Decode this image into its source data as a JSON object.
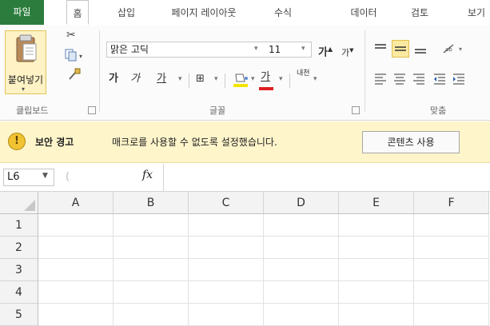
{
  "tabs": {
    "file": "파일",
    "home": "홈",
    "insert": "삽입",
    "page_layout": "페이지 레이아웃",
    "formulas": "수식",
    "data": "데이터",
    "review": "검토",
    "view": "보기"
  },
  "ribbon": {
    "clipboard": {
      "paste_label": "붙여넣기",
      "group_label": "클립보드"
    },
    "font": {
      "font_name": "맑은 고딕",
      "font_size": "11",
      "grow": "가",
      "shrink": "가",
      "bold": "가",
      "italic": "가",
      "underline": "가",
      "font_color_glyph": "가",
      "phonetic": "내천",
      "group_label": "글꼴"
    },
    "alignment": {
      "group_label": "맞춤"
    }
  },
  "security_bar": {
    "title": "보안 경고",
    "message": "매크로를 사용할 수 없도록 설정했습니다.",
    "enable_button": "콘텐츠 사용"
  },
  "formula_bar": {
    "name_box": "L6",
    "fx": "fx",
    "formula": ""
  },
  "grid": {
    "columns": [
      "A",
      "B",
      "C",
      "D",
      "E",
      "F"
    ],
    "rows": [
      "1",
      "2",
      "3",
      "4",
      "5"
    ]
  },
  "colors": {
    "file_tab": "#2c7d3d",
    "security_bar": "#fff5cb",
    "font_color_underline": "#e02020",
    "highlight_yellow": "#f5e400"
  }
}
